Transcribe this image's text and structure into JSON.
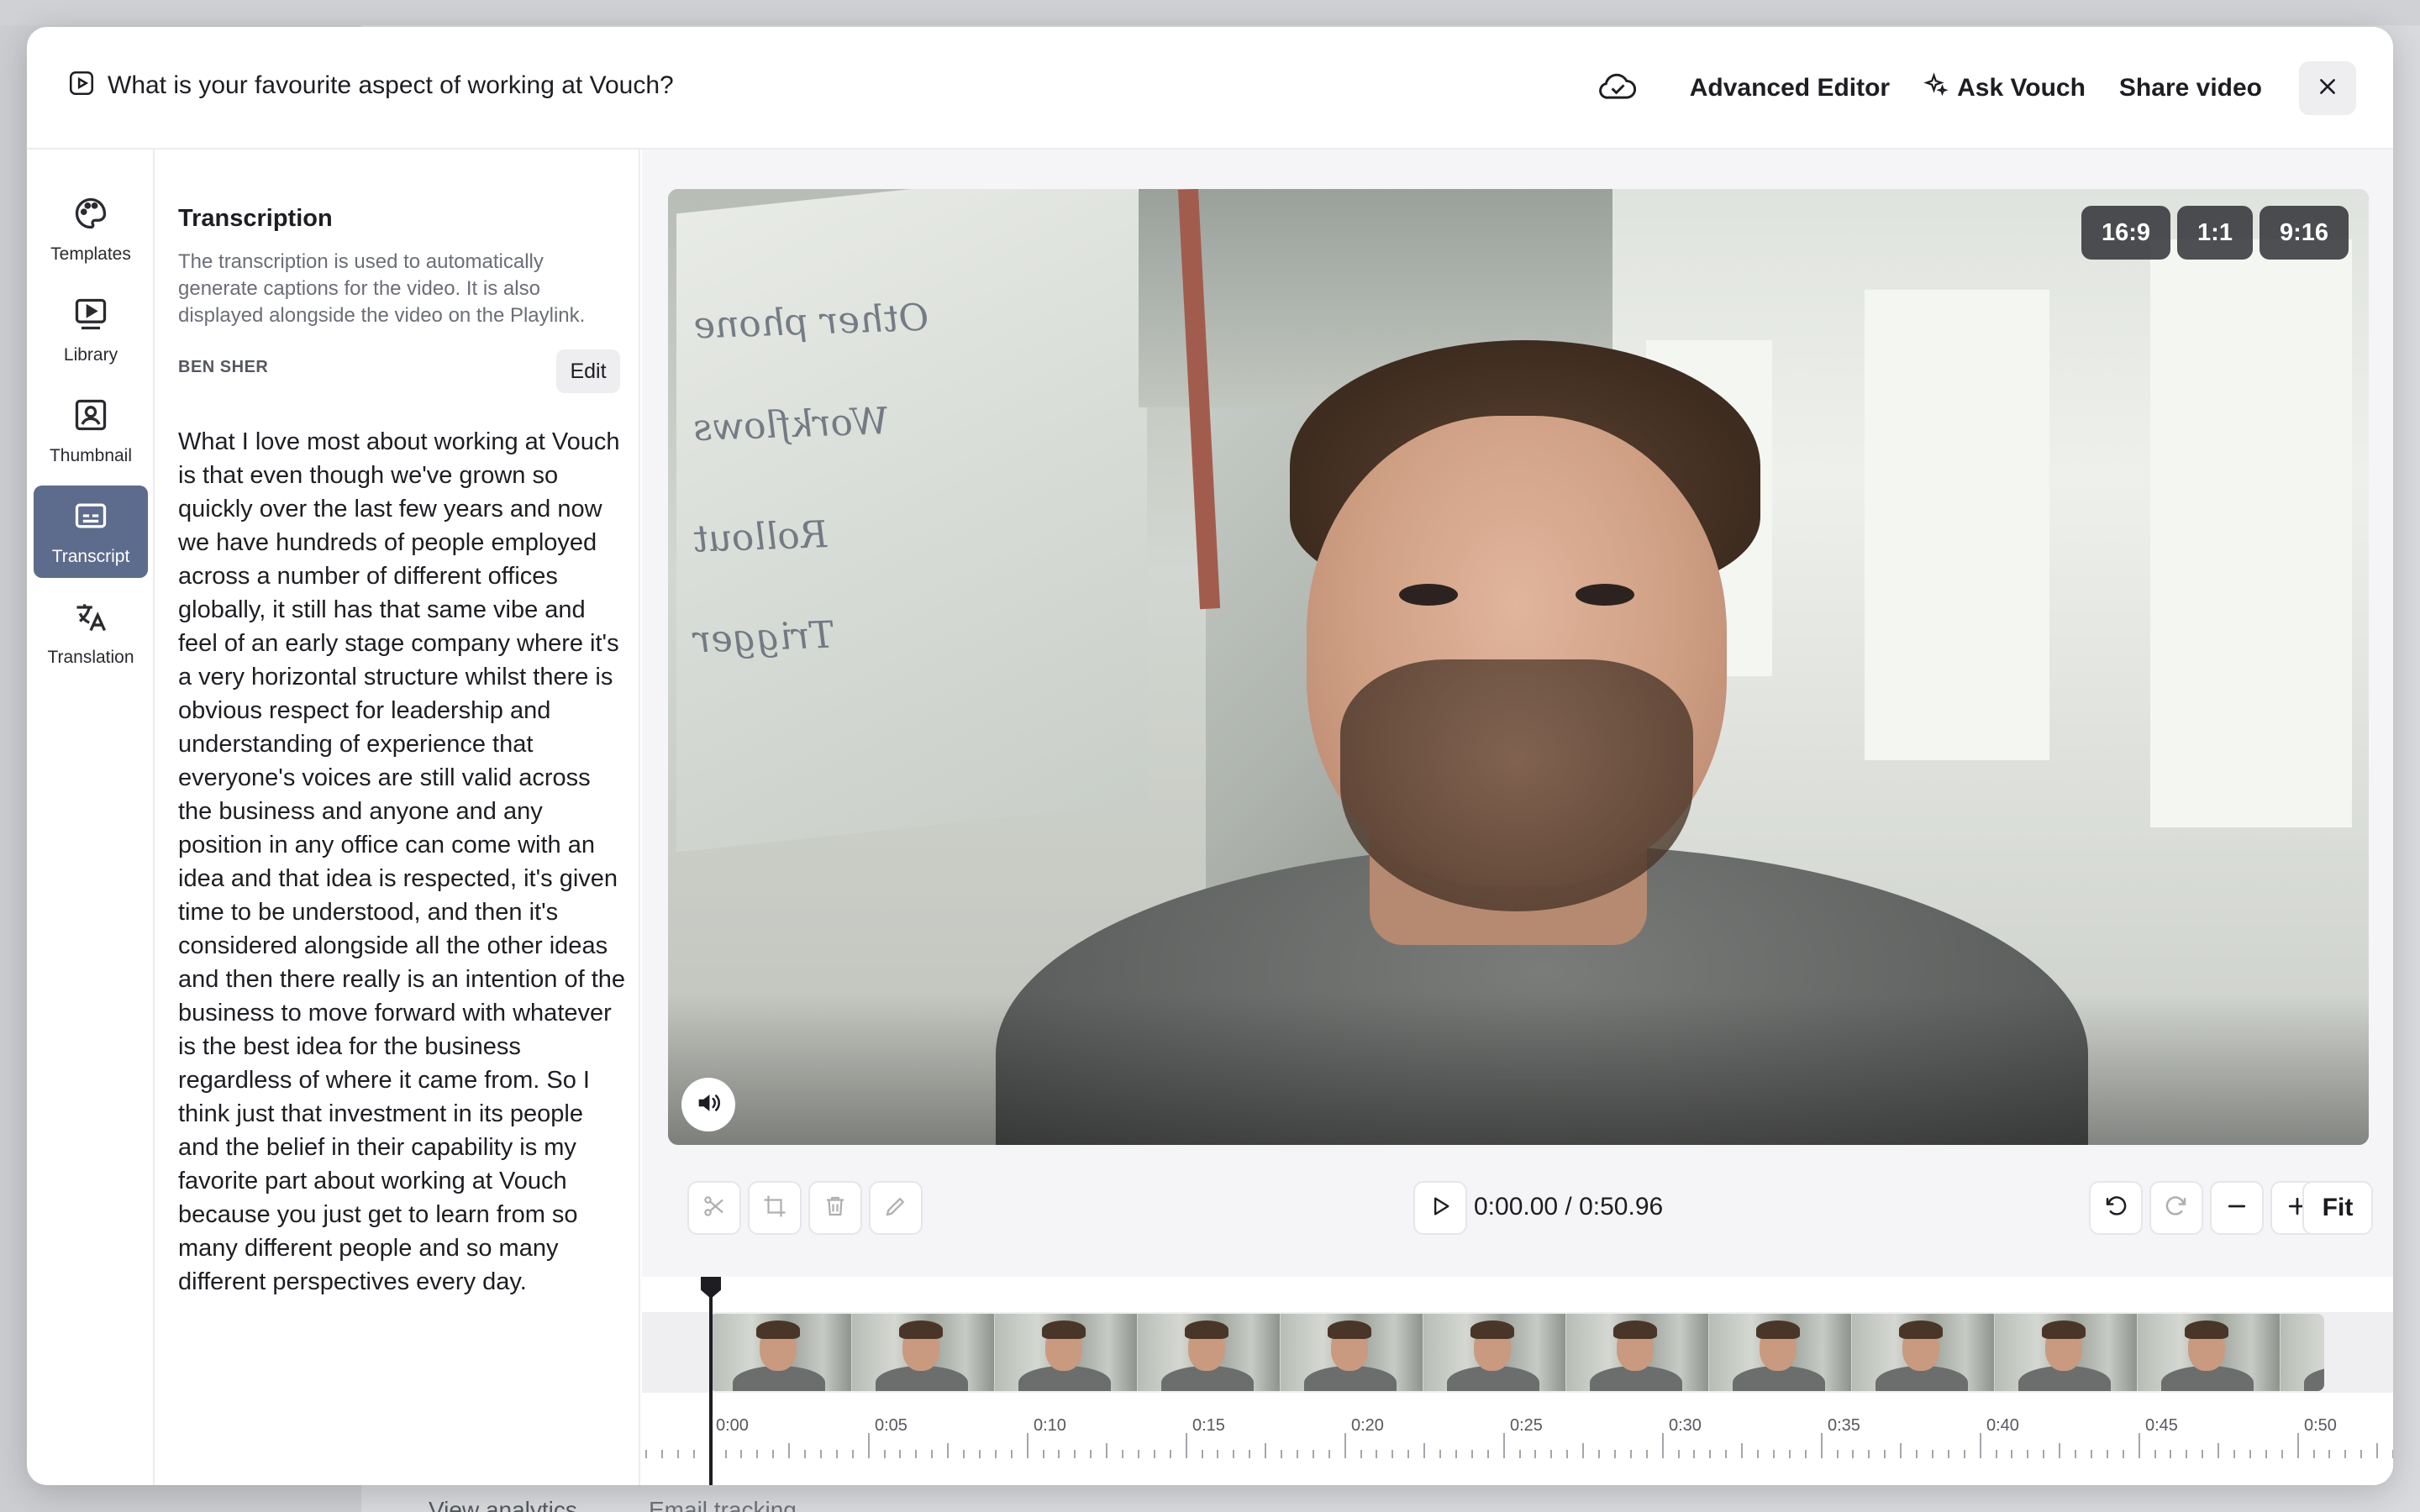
{
  "background": {
    "link_analytics": "View analytics",
    "link_email": "Email tracking"
  },
  "header": {
    "title": "What is your favourite aspect of working at Vouch?",
    "advanced_editor": "Advanced Editor",
    "ask_vouch": "Ask Vouch",
    "share_video": "Share video"
  },
  "nav": {
    "items": [
      {
        "label": "Templates",
        "icon": "palette-icon"
      },
      {
        "label": "Library",
        "icon": "library-play-icon"
      },
      {
        "label": "Thumbnail",
        "icon": "portrait-icon"
      },
      {
        "label": "Transcript",
        "icon": "subtitles-icon",
        "active": true
      },
      {
        "label": "Translation",
        "icon": "translate-icon"
      }
    ]
  },
  "transcription": {
    "title": "Transcription",
    "description": "The transcription is used to automatically generate captions for the video. It is also displayed alongside the video on the Playlink.",
    "speaker": "BEN SHER",
    "edit_label": "Edit",
    "text": "What I love most about working at Vouch is that even though we've grown so quickly over the last few years and now we have hundreds of people employed across a number of different offices globally, it still has that same vibe and feel of an early stage company where it's a very horizontal structure whilst there is obvious respect for leadership and understanding of experience that everyone's voices are still valid across the business and anyone and any position in any office can come with an idea and that idea is respected, it's given time to be understood, and then it's considered alongside all the other ideas and then there really is an intention of the business to move forward with whatever is the best idea for the business regardless of where it came from. So I think just that investment in its people and the belief in their capability is my favorite part about working at Vouch because you just get to learn from so many different people and so many different perspectives every day."
  },
  "video": {
    "aspect_ratios": [
      "16:9",
      "1:1",
      "9:16"
    ]
  },
  "player": {
    "timecode": "0:00.00 / 0:50.96",
    "fit_label": "Fit"
  },
  "timeline": {
    "labels": [
      "0:00",
      "0:05",
      "0:10",
      "0:15",
      "0:20",
      "0:25",
      "0:30",
      "0:35",
      "0:40",
      "0:45",
      "0:50"
    ]
  },
  "colors": {
    "accent_nav_active": "#5d6b8c",
    "ratio_chip": "#2a2c32"
  }
}
